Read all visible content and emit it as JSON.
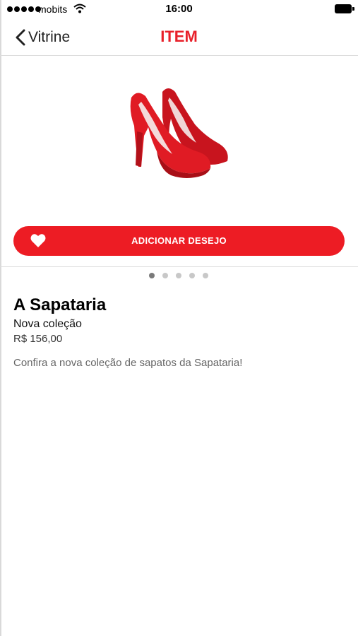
{
  "status_bar": {
    "carrier": "mobits",
    "time": "16:00"
  },
  "nav": {
    "back_label": "Vitrine",
    "title": "ITEM"
  },
  "wish_button": {
    "label": "ADICIONAR DESEJO"
  },
  "pager": {
    "count": 5,
    "active": 1
  },
  "product": {
    "store": "A Sapataria",
    "subtitle": "Nova coleção",
    "price": "R$ 156,00",
    "description": "Confira a nova coleção de sapatos da Sapataria!"
  },
  "colors": {
    "accent": "#ed1c24",
    "title": "#e8202a"
  },
  "icons": [
    "signal-icon",
    "wifi-icon",
    "battery-icon",
    "back-chevron-icon",
    "heart-icon"
  ]
}
